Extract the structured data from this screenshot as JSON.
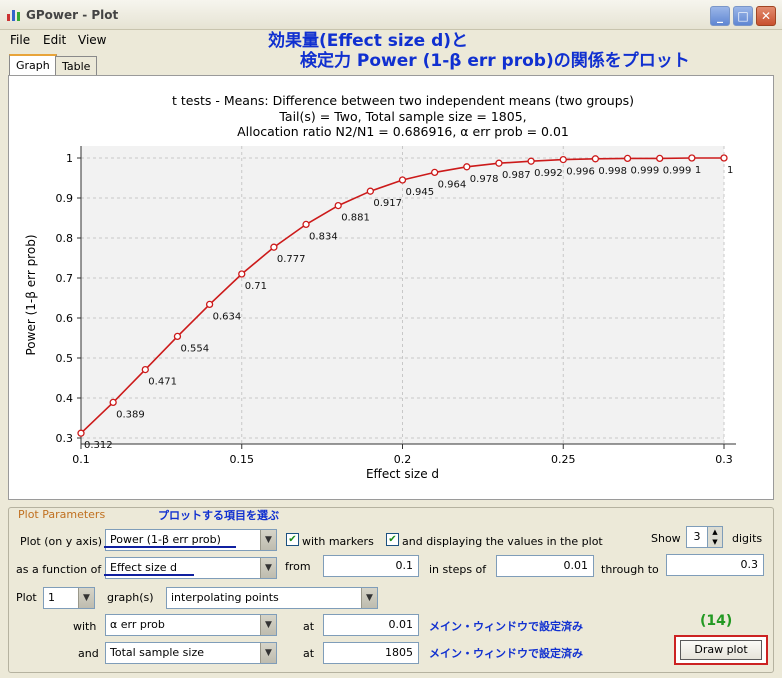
{
  "window": {
    "title": "GPower - Plot"
  },
  "annotations": {
    "title_line1": "効果量(Effect size d)と",
    "title_line2": "検定力 Power (1-β err prob)の関係をプロット",
    "select_items": "プロットする項目を選ぶ",
    "set_in_main_1": "メイン・ウィンドウで設定済み",
    "set_in_main_2": "メイン・ウィンドウで設定済み",
    "step_number": "(14)"
  },
  "menu": {
    "file": "File",
    "edit": "Edit",
    "view": "View"
  },
  "tabs": {
    "graph": "Graph",
    "table": "Table"
  },
  "chart_data": {
    "type": "line",
    "title": "t tests - Means: Difference between two independent means (two groups)",
    "subtitle1": "Tail(s) = Two, Total sample size = 1805,",
    "subtitle2": "Allocation ratio N2/N1 = 0.686916, α err prob = 0.01",
    "xlabel": "Effect size d",
    "ylabel": "Power (1-β err prob)",
    "xlim": [
      0.1,
      0.3
    ],
    "ylim": [
      0.3,
      1.0
    ],
    "xticks": [
      "0.1",
      "0.15",
      "0.2",
      "0.25",
      "0.3"
    ],
    "yticks": [
      "0.3",
      "0.4",
      "0.5",
      "0.6",
      "0.7",
      "0.8",
      "0.9",
      "1"
    ],
    "x": [
      0.1,
      0.11,
      0.12,
      0.13,
      0.14,
      0.15,
      0.16,
      0.17,
      0.18,
      0.19,
      0.2,
      0.21,
      0.22,
      0.23,
      0.24,
      0.25,
      0.26,
      0.27,
      0.28,
      0.29,
      0.3
    ],
    "values": [
      0.312,
      0.389,
      0.471,
      0.554,
      0.634,
      0.71,
      0.777,
      0.834,
      0.881,
      0.917,
      0.945,
      0.964,
      0.978,
      0.987,
      0.992,
      0.996,
      0.998,
      0.999,
      0.999,
      1,
      1
    ],
    "labels": [
      "0.312",
      "0.389",
      "0.471",
      "0.554",
      "0.634",
      "0.71",
      "0.777",
      "0.834",
      "0.881",
      "0.917",
      "0.945",
      "0.964",
      "0.978",
      "0.987",
      "0.992",
      "0.996",
      "0.998",
      "0.999",
      "0.999",
      "1",
      "1"
    ],
    "line_color": "#cc1a1a",
    "grid": true
  },
  "params": {
    "group_label": "Plot Parameters",
    "plot_on_y_label": "Plot (on y axis)",
    "plot_on_y_value": "Power (1-β err prob)",
    "with_markers": "with markers",
    "and_displaying": "and displaying the values in the plot",
    "show_label": "Show",
    "show_digits": "3",
    "digits_label": "digits",
    "as_function_label": "as a function of",
    "as_function_value": "Effect size d",
    "from_label": "from",
    "from_value": "0.1",
    "in_steps_label": "in steps of",
    "steps_value": "0.01",
    "through_label": "through to",
    "through_value": "0.3",
    "plot_label": "Plot",
    "plot_count": "1",
    "graphs_label": "graph(s)",
    "interp_value": "interpolating points",
    "with_label": "with",
    "with_value": "α err prob",
    "at_label_1": "at",
    "alpha_value": "0.01",
    "and_label": "and",
    "and_value": "Total sample size",
    "at_label_2": "at",
    "n_value": "1805",
    "draw_plot": "Draw plot"
  }
}
